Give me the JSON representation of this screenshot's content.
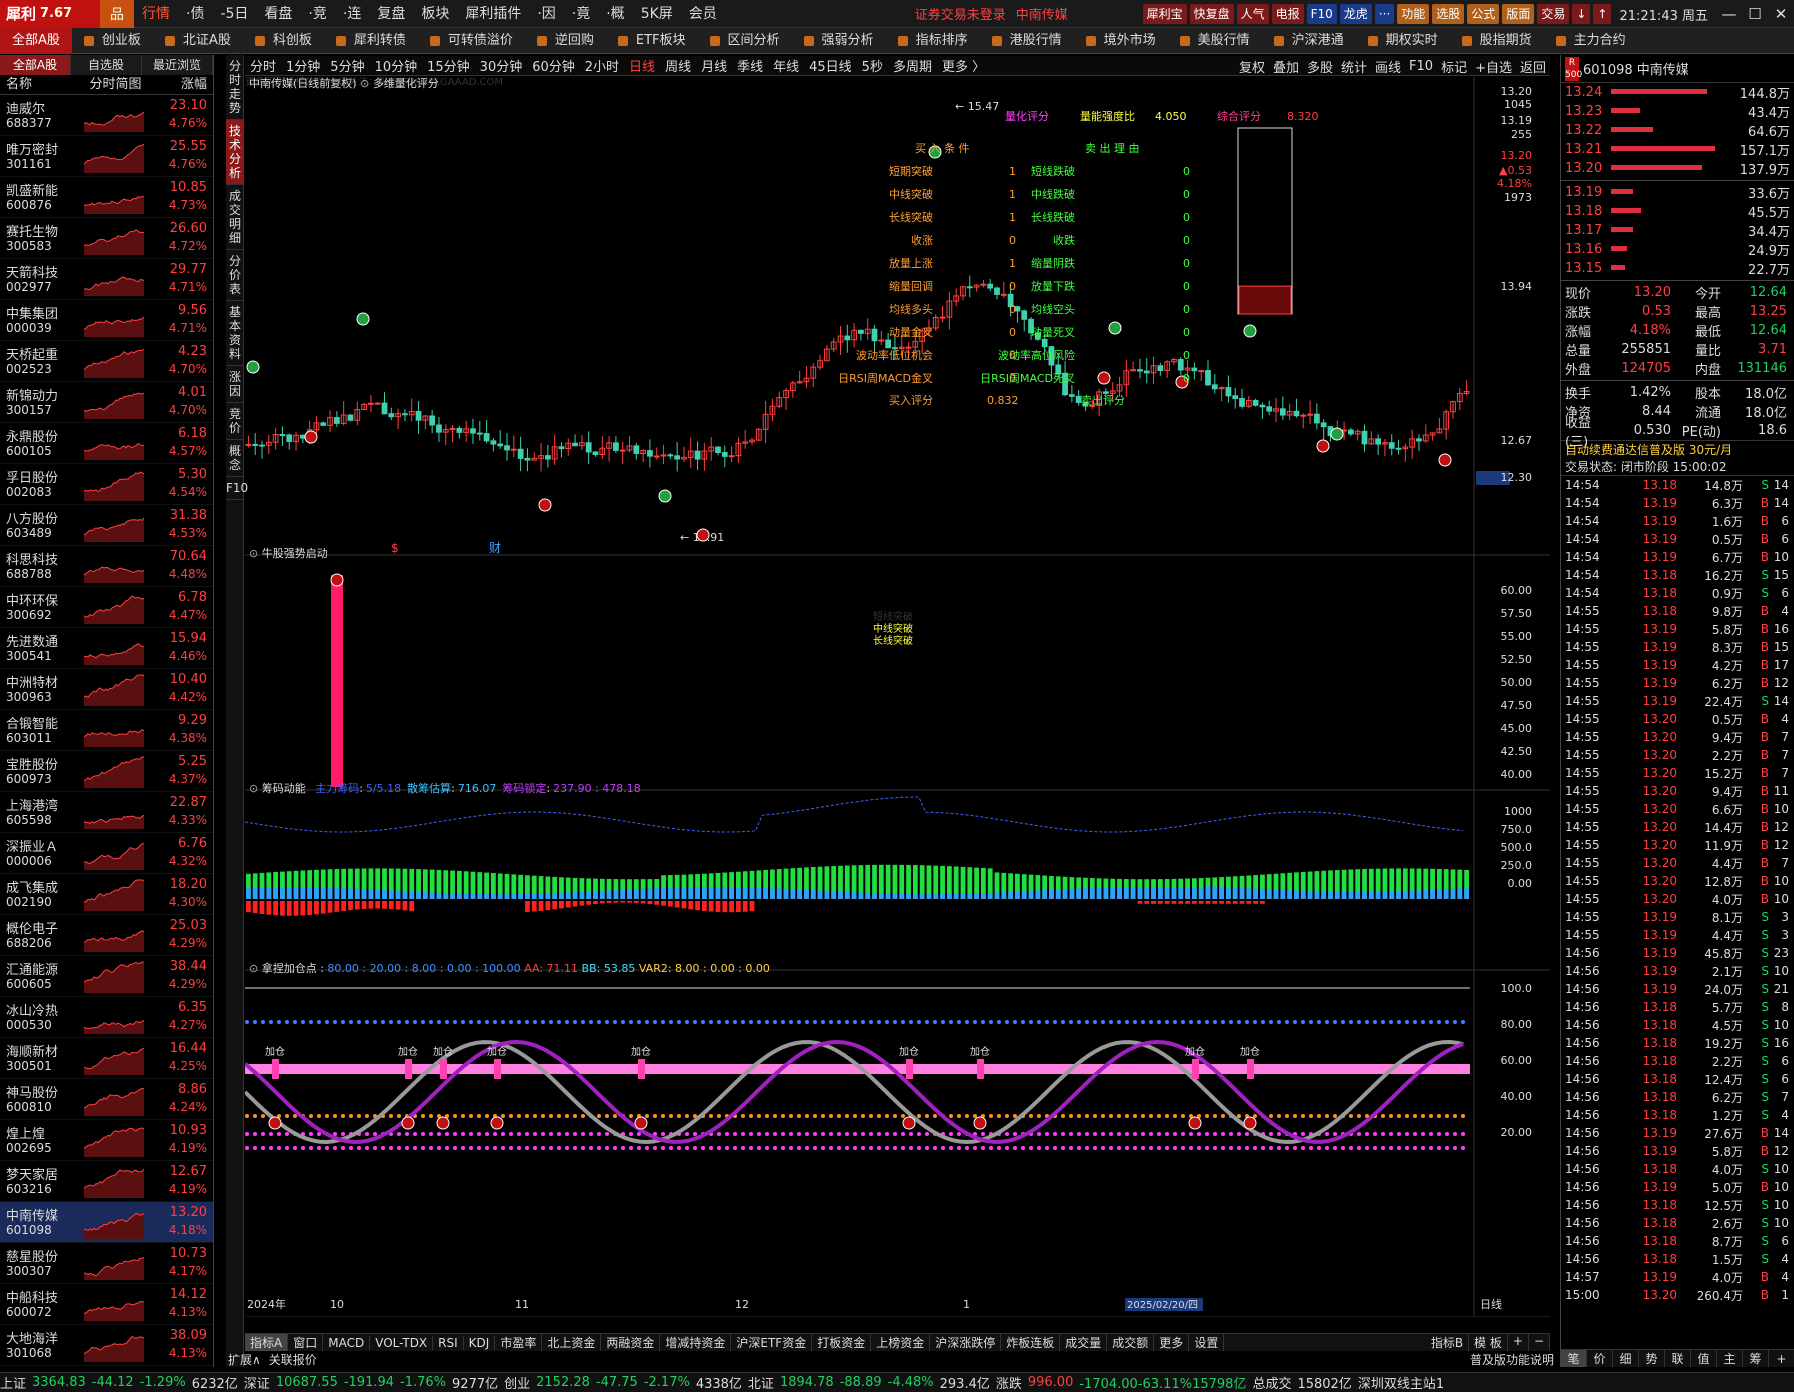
{
  "app": {
    "logo": "犀利",
    "version": "7.67",
    "menu": [
      "行情",
      "·债",
      "-5日",
      "看盘",
      "·竞",
      "·连",
      "复盘",
      "板块",
      "犀利插件",
      "·因",
      "·竟",
      "·概",
      "5K屏",
      "会员"
    ],
    "login_warning": "证券交易未登录",
    "current_stock": "中南传媒",
    "buttons": [
      "犀利宝",
      "快复盘",
      "人气",
      "电报",
      "F10",
      "龙虎",
      "···",
      "功能",
      "选股",
      "公式",
      "版面",
      "交易",
      "↓",
      "↑"
    ],
    "clock": "21:21:43 周五"
  },
  "board_tabs": [
    "全部A股",
    "创业板",
    "北证A股",
    "科创板",
    "犀利转债",
    "可转债溢价",
    "逆回购",
    "ETF板块",
    "区间分析",
    "强弱分析",
    "指标排序",
    "港股行情",
    "境外市场",
    "美股行情",
    "沪深港通",
    "期权实时",
    "股指期货",
    "主力合约"
  ],
  "left_tabs": [
    "全部A股",
    "自选股",
    "最近浏览"
  ],
  "list_header": {
    "name": "名称",
    "chart": "分时简图",
    "pct": "涨幅"
  },
  "stocks": [
    {
      "name": "迪威尔",
      "code": "688377",
      "price": "23.10",
      "pct": "4.76%"
    },
    {
      "name": "唯万密封",
      "code": "301161",
      "price": "25.55",
      "pct": "4.76%"
    },
    {
      "name": "凯盛新能",
      "code": "600876",
      "price": "10.85",
      "pct": "4.73%"
    },
    {
      "name": "赛托生物",
      "code": "300583",
      "price": "26.60",
      "pct": "4.72%"
    },
    {
      "name": "天箭科技",
      "code": "002977",
      "price": "29.77",
      "pct": "4.71%"
    },
    {
      "name": "中集集团",
      "code": "000039",
      "price": "9.56",
      "pct": "4.71%"
    },
    {
      "name": "天桥起重",
      "code": "002523",
      "price": "4.23",
      "pct": "4.70%"
    },
    {
      "name": "新锦动力",
      "code": "300157",
      "price": "4.01",
      "pct": "4.70%"
    },
    {
      "name": "永鼎股份",
      "code": "600105",
      "price": "6.18",
      "pct": "4.57%"
    },
    {
      "name": "孚日股份",
      "code": "002083",
      "price": "5.30",
      "pct": "4.54%"
    },
    {
      "name": "八方股份",
      "code": "603489",
      "price": "31.38",
      "pct": "4.53%"
    },
    {
      "name": "科思科技",
      "code": "688788",
      "price": "70.64",
      "pct": "4.48%"
    },
    {
      "name": "中环环保",
      "code": "300692",
      "price": "6.78",
      "pct": "4.47%"
    },
    {
      "name": "先进数通",
      "code": "300541",
      "price": "15.94",
      "pct": "4.46%"
    },
    {
      "name": "中洲特材",
      "code": "300963",
      "price": "10.40",
      "pct": "4.42%"
    },
    {
      "name": "合锻智能",
      "code": "603011",
      "price": "9.29",
      "pct": "4.38%"
    },
    {
      "name": "宝胜股份",
      "code": "600973",
      "price": "5.25",
      "pct": "4.37%"
    },
    {
      "name": "上海港湾",
      "code": "605598",
      "price": "22.87",
      "pct": "4.33%"
    },
    {
      "name": "深振业Ａ",
      "code": "000006",
      "price": "6.76",
      "pct": "4.32%"
    },
    {
      "name": "成飞集成",
      "code": "002190",
      "price": "18.20",
      "pct": "4.30%"
    },
    {
      "name": "概伦电子",
      "code": "688206",
      "price": "25.03",
      "pct": "4.29%"
    },
    {
      "name": "汇通能源",
      "code": "600605",
      "price": "38.44",
      "pct": "4.29%"
    },
    {
      "name": "冰山冷热",
      "code": "000530",
      "price": "6.35",
      "pct": "4.27%"
    },
    {
      "name": "海顺新材",
      "code": "300501",
      "price": "16.44",
      "pct": "4.25%"
    },
    {
      "name": "神马股份",
      "code": "600810",
      "price": "8.86",
      "pct": "4.24%"
    },
    {
      "name": "煌上煌",
      "code": "002695",
      "price": "10.93",
      "pct": "4.19%"
    },
    {
      "name": "梦天家居",
      "code": "603216",
      "price": "12.67",
      "pct": "4.19%"
    },
    {
      "name": "中南传媒",
      "code": "601098",
      "price": "13.20",
      "pct": "4.18%"
    },
    {
      "name": "慈星股份",
      "code": "300307",
      "price": "10.73",
      "pct": "4.17%"
    },
    {
      "name": "中船科技",
      "code": "600072",
      "price": "14.12",
      "pct": "4.13%"
    },
    {
      "name": "大地海洋",
      "code": "301068",
      "price": "38.09",
      "pct": "4.13%"
    }
  ],
  "vertical_tabs": [
    "分时走势",
    "技术分析",
    "成交明细",
    "分价表",
    "基本资料",
    "涨因",
    "竞价",
    "概念",
    "F10"
  ],
  "periods": [
    "分时",
    "1分钟",
    "5分钟",
    "10分钟",
    "15分钟",
    "30分钟",
    "60分钟",
    "2小时",
    "日线",
    "周线",
    "月线",
    "季线",
    "年线",
    "45日线",
    "5秒",
    "多周期",
    "更多 〉"
  ],
  "tools": [
    "复权",
    "叠加",
    "多股",
    "统计",
    "画线",
    "F10",
    "标记",
    "+自选",
    "返回"
  ],
  "main_panel": {
    "title": "中南传媒(日线前复权)",
    "indicator": "多维量化评分",
    "watermark": "更多实用指标公众号 请关注：股友达WWW.GAAAD.COM",
    "high_label": "15.47",
    "low_label": "11.91",
    "y_ticks": [
      "13.20",
      "1045",
      "13.19",
      "255",
      "13.20",
      "▲0.53",
      "4.18%",
      "1973",
      "13.94",
      "12.67",
      "12.30"
    ],
    "x_ticks": [
      "2024年",
      "10",
      "11",
      "12",
      "1",
      "2"
    ],
    "markers": [
      "$",
      "财"
    ],
    "score_header": {
      "label1": "量化评分",
      "label2": "量能强度比",
      "val2": "4.050",
      "label3": "综合评分",
      "val3": "8.320"
    },
    "buy_title": "买 入 条 件",
    "sell_title": "卖 出 理 由",
    "buy_items": [
      {
        "label": "短期突破",
        "value": "1"
      },
      {
        "label": "中线突破",
        "value": "1"
      },
      {
        "label": "长线突破",
        "value": "1"
      },
      {
        "label": "收涨",
        "value": "0"
      },
      {
        "label": "放量上涨",
        "value": "1"
      },
      {
        "label": "缩量回调",
        "value": "0"
      },
      {
        "label": "均线多头",
        "value": "0"
      },
      {
        "label": "动量金叉",
        "value": "0"
      },
      {
        "label": "波动率低位机会",
        "value": "0"
      },
      {
        "label": "日RSI周MACD金叉",
        "value": "0"
      }
    ],
    "sell_items": [
      {
        "label": "短线跌破",
        "value": "0"
      },
      {
        "label": "中线跌破",
        "value": "0"
      },
      {
        "label": "长线跌破",
        "value": "0"
      },
      {
        "label": "收跌",
        "value": "0"
      },
      {
        "label": "缩量阴跌",
        "value": "0"
      },
      {
        "label": "放量下跌",
        "value": "0"
      },
      {
        "label": "均线空头",
        "value": "0"
      },
      {
        "label": "动量死叉",
        "value": "0"
      },
      {
        "label": "波动率高位风险",
        "value": "0"
      },
      {
        "label": "日RSI周MACD死叉",
        "value": "0"
      }
    ],
    "buy_score_label": "买入评分",
    "buy_score": "0.832",
    "sell_score_label": "卖出评分",
    "score_gauge": 0.15
  },
  "panel2": {
    "title": "牛股强势启动",
    "labels": [
      "短线突破",
      "中线突破",
      "长线突破"
    ],
    "y_ticks": [
      "60.00",
      "57.50",
      "55.00",
      "52.50",
      "50.00",
      "47.50",
      "45.00",
      "42.50",
      "40.00"
    ]
  },
  "panel3": {
    "title": "筹码动能",
    "items": [
      {
        "label": "主力筹码",
        "value": "5/5.18",
        "color": "#4060ff"
      },
      {
        "label": "散筹估算",
        "value": "716.07",
        "color": "#40c0ff"
      },
      {
        "label": "筹码锁定",
        "value": "237.90 : 478.18",
        "color": "#c040ff"
      }
    ],
    "y_ticks": [
      "1000",
      "750.0",
      "500.0",
      "250.0",
      "0.00"
    ]
  },
  "panel4": {
    "title": "拿捏加仓点",
    "values": "80.00 : 20.00 : 8.00 : 0.00 : 100.00",
    "aa": "AA: 71.11",
    "bb": "BB: 53.85",
    "var2": "VAR2: 8.00 : 0.00 : 0.00",
    "add_label": "加仓",
    "y_ticks": [
      "100.0",
      "80.00",
      "60.00",
      "40.00",
      "20.00"
    ],
    "date_label": "2025/02/20/四"
  },
  "axis_label": "日线",
  "indicator_tabs": [
    "指标A",
    "窗口",
    "MACD",
    "VOL-TDX",
    "RSI",
    "KDJ",
    "市盈率",
    "北上资金",
    "两融资金",
    "增减持资金",
    "沪深ETF资金",
    "打板资金",
    "上榜资金",
    "沪深涨跌停",
    "炸板连板",
    "成交量",
    "成交额",
    "更多",
    "设置"
  ],
  "indicator_right": [
    "指标B",
    "模 板",
    "+",
    "−"
  ],
  "expand_row": [
    "扩展∧",
    "关联报价"
  ],
  "right": {
    "title": "601098 中南传媒",
    "badge": "R 500",
    "asks": [
      {
        "price": "13.24",
        "vol": "144.8万",
        "bar": 0.6
      },
      {
        "price": "13.23",
        "vol": "43.4万",
        "bar": 0.18
      },
      {
        "price": "13.22",
        "vol": "64.6万",
        "bar": 0.26
      },
      {
        "price": "13.21",
        "vol": "157.1万",
        "bar": 0.65
      },
      {
        "price": "13.20",
        "vol": "137.9万",
        "bar": 0.57
      }
    ],
    "bids": [
      {
        "price": "13.19",
        "vol": "33.6万",
        "bar": 0.14
      },
      {
        "price": "13.18",
        "vol": "45.5万",
        "bar": 0.19
      },
      {
        "price": "13.17",
        "vol": "34.4万",
        "bar": 0.14
      },
      {
        "price": "13.16",
        "vol": "24.9万",
        "bar": 0.1
      },
      {
        "price": "13.15",
        "vol": "22.7万",
        "bar": 0.09
      }
    ],
    "stats": [
      [
        "现价",
        "13.20",
        "今开",
        "12.64",
        "red",
        "green"
      ],
      [
        "涨跌",
        "0.53",
        "最高",
        "13.25",
        "red",
        "red"
      ],
      [
        "涨幅",
        "4.18%",
        "最低",
        "12.64",
        "red",
        "green"
      ],
      [
        "总量",
        "255851",
        "量比",
        "3.71",
        "white",
        "red"
      ],
      [
        "外盘",
        "124705",
        "内盘",
        "131146",
        "red",
        "green"
      ]
    ],
    "stats2": [
      [
        "换手",
        "1.42%",
        "股本",
        "18.0亿"
      ],
      [
        "净资",
        "8.44",
        "流通",
        "18.0亿"
      ],
      [
        "收益(三)",
        "0.530",
        "PE(动)",
        "18.6"
      ]
    ],
    "auto_info": "自动续费通达信普及版  30元/月",
    "trade_state": "交易状态: 闭市阶段 15:00:02",
    "ticks": [
      [
        "14:54",
        "13.18",
        "14.8万",
        "S",
        "14"
      ],
      [
        "14:54",
        "13.19",
        "6.3万",
        "B",
        "14"
      ],
      [
        "14:54",
        "13.19",
        "1.6万",
        "B",
        "6"
      ],
      [
        "14:54",
        "13.19",
        "0.5万",
        "B",
        "6"
      ],
      [
        "14:54",
        "13.19",
        "6.7万",
        "B",
        "10"
      ],
      [
        "14:54",
        "13.18",
        "16.2万",
        "S",
        "15"
      ],
      [
        "14:54",
        "13.18",
        "0.9万",
        "S",
        "6"
      ],
      [
        "14:55",
        "13.18",
        "9.8万",
        "B",
        "4"
      ],
      [
        "14:55",
        "13.19",
        "5.8万",
        "B",
        "16"
      ],
      [
        "14:55",
        "13.19",
        "8.3万",
        "B",
        "15"
      ],
      [
        "14:55",
        "13.19",
        "4.2万",
        "B",
        "17"
      ],
      [
        "14:55",
        "13.19",
        "6.2万",
        "B",
        "12"
      ],
      [
        "14:55",
        "13.19",
        "22.4万",
        "S",
        "14"
      ],
      [
        "14:55",
        "13.20",
        "0.5万",
        "B",
        "4"
      ],
      [
        "14:55",
        "13.20",
        "9.4万",
        "B",
        "7"
      ],
      [
        "14:55",
        "13.20",
        "2.2万",
        "B",
        "7"
      ],
      [
        "14:55",
        "13.20",
        "15.2万",
        "B",
        "7"
      ],
      [
        "14:55",
        "13.20",
        "9.4万",
        "B",
        "11"
      ],
      [
        "14:55",
        "13.20",
        "6.6万",
        "B",
        "10"
      ],
      [
        "14:55",
        "13.20",
        "14.4万",
        "B",
        "12"
      ],
      [
        "14:55",
        "13.20",
        "11.9万",
        "B",
        "12"
      ],
      [
        "14:55",
        "13.20",
        "4.4万",
        "B",
        "7"
      ],
      [
        "14:55",
        "13.20",
        "12.8万",
        "B",
        "10"
      ],
      [
        "14:55",
        "13.20",
        "4.0万",
        "B",
        "10"
      ],
      [
        "14:55",
        "13.19",
        "8.1万",
        "S",
        "3"
      ],
      [
        "14:55",
        "13.19",
        "4.4万",
        "S",
        "3"
      ],
      [
        "14:56",
        "13.19",
        "45.8万",
        "S",
        "23"
      ],
      [
        "14:56",
        "13.19",
        "2.1万",
        "S",
        "10"
      ],
      [
        "14:56",
        "13.19",
        "24.0万",
        "S",
        "21"
      ],
      [
        "14:56",
        "13.18",
        "5.7万",
        "S",
        "8"
      ],
      [
        "14:56",
        "13.18",
        "4.5万",
        "S",
        "10"
      ],
      [
        "14:56",
        "13.18",
        "19.2万",
        "S",
        "16"
      ],
      [
        "14:56",
        "13.18",
        "2.2万",
        "S",
        "6"
      ],
      [
        "14:56",
        "13.18",
        "12.4万",
        "S",
        "6"
      ],
      [
        "14:56",
        "13.18",
        "6.2万",
        "S",
        "7"
      ],
      [
        "14:56",
        "13.18",
        "1.2万",
        "S",
        "4"
      ],
      [
        "14:56",
        "13.19",
        "27.6万",
        "B",
        "14"
      ],
      [
        "14:56",
        "13.19",
        "5.8万",
        "B",
        "12"
      ],
      [
        "14:56",
        "13.18",
        "4.0万",
        "S",
        "10"
      ],
      [
        "14:56",
        "13.19",
        "5.0万",
        "B",
        "10"
      ],
      [
        "14:56",
        "13.18",
        "12.5万",
        "S",
        "10"
      ],
      [
        "14:56",
        "13.18",
        "2.6万",
        "S",
        "10"
      ],
      [
        "14:56",
        "13.18",
        "8.7万",
        "S",
        "6"
      ],
      [
        "14:56",
        "13.18",
        "1.5万",
        "S",
        "4"
      ],
      [
        "14:57",
        "13.19",
        "4.0万",
        "B",
        "4"
      ],
      [
        "15:00",
        "13.20",
        "260.4万",
        "B",
        "1"
      ]
    ],
    "foot": [
      "笔",
      "价",
      "细",
      "势",
      "联",
      "值",
      "主",
      "筹",
      "+"
    ],
    "footnote": "普及版功能说明"
  },
  "status": {
    "items": [
      {
        "label": "上证",
        "val": "3364.83",
        "chg": "-44.12",
        "pct": "-1.29%",
        "amt": "6232亿"
      },
      {
        "label": "深证",
        "val": "10687.55",
        "chg": "-191.94",
        "pct": "-1.76%",
        "amt": "9277亿"
      },
      {
        "label": "创业",
        "val": "2152.28",
        "chg": "-47.75",
        "pct": "-2.17%",
        "amt": "4338亿"
      },
      {
        "label": "北证",
        "val": "1894.78",
        "chg": "-88.89",
        "pct": "-4.48%",
        "amt": "293.4亿"
      }
    ],
    "zhangdie_label": "涨跌",
    "zhangdie": "996.00",
    "zhangdie2": "-1704.00-63.11%15798亿",
    "total_label": "总成交",
    "total": "15802亿",
    "server": "深圳双线主站1"
  },
  "colors": {
    "up": "#ff4040",
    "down": "#20d0a0",
    "accent": "#c01010"
  }
}
